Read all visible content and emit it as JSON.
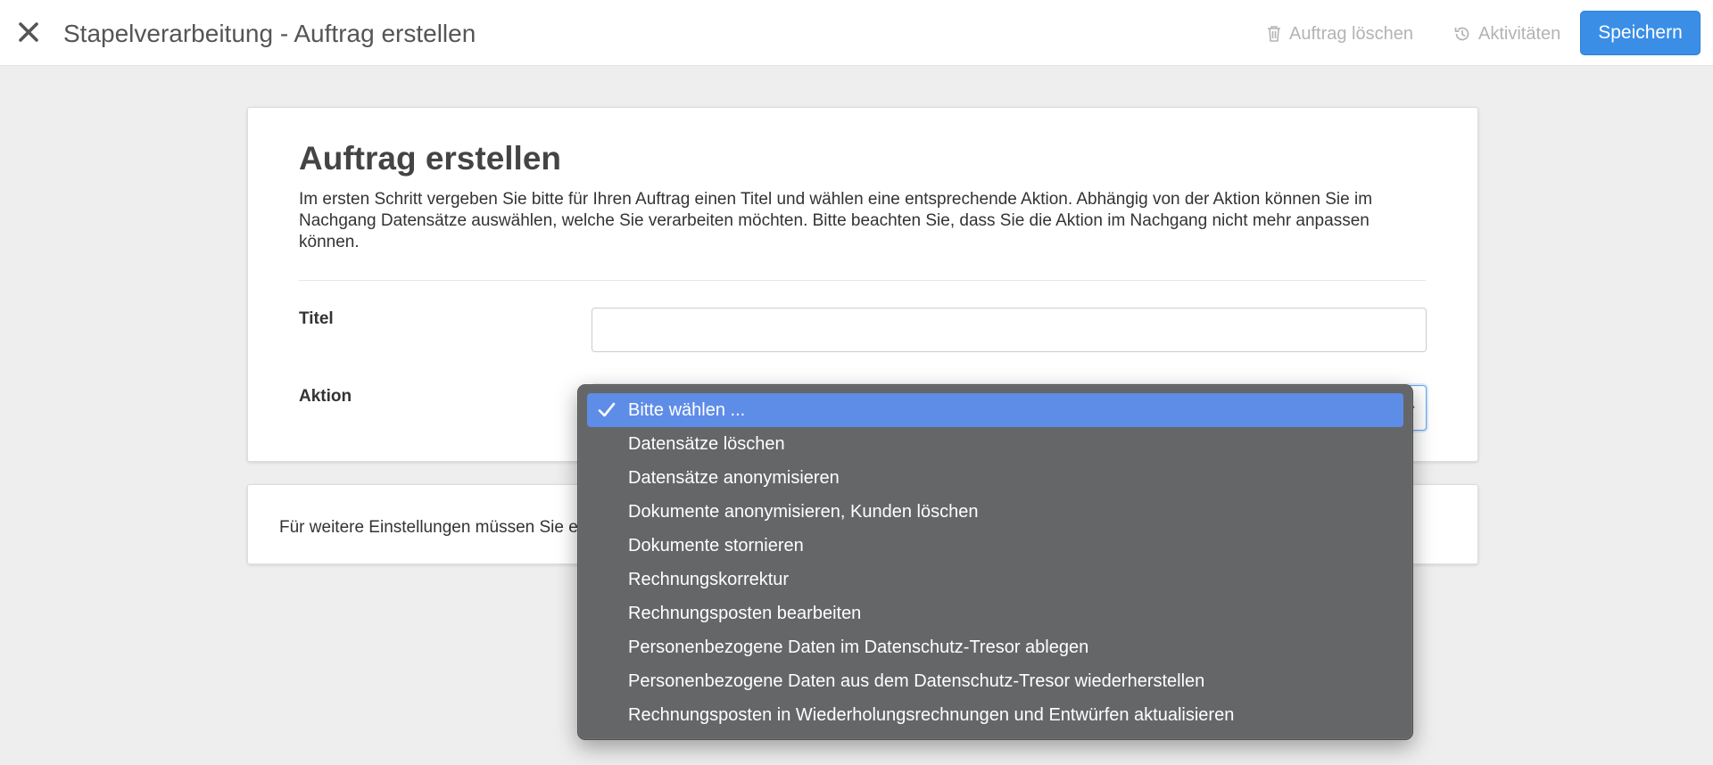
{
  "header": {
    "title": "Stapelverarbeitung - Auftrag erstellen",
    "delete_label": "Auftrag löschen",
    "activities_label": "Aktivitäten",
    "save_label": "Speichern"
  },
  "form": {
    "heading": "Auftrag erstellen",
    "description": "Im ersten Schritt vergeben Sie bitte für Ihren Auftrag einen Titel und wählen eine entsprechende Aktion. Abhängig von der Aktion können Sie im Nachgang Datensätze auswählen, welche Sie verarbeiten möchten. Bitte beachten Sie, dass Sie die Aktion im Nachgang nicht mehr anpassen können.",
    "title_label": "Titel",
    "title_value": "",
    "action_label": "Aktion"
  },
  "info": {
    "text": "Für weitere Einstellungen müssen Sie e"
  },
  "dropdown": {
    "selected_index": 0,
    "options": [
      "Bitte wählen ...",
      "Datensätze löschen",
      "Datensätze anonymisieren",
      "Dokumente anonymisieren, Kunden löschen",
      "Dokumente stornieren",
      "Rechnungskorrektur",
      "Rechnungsposten bearbeiten",
      "Personenbezogene Daten im Datenschutz-Tresor ablegen",
      "Personenbezogene Daten aus dem Datenschutz-Tresor wiederherstellen",
      "Rechnungsposten in Wiederholungsrechnungen und Entwürfen aktualisieren"
    ]
  },
  "icons": {
    "close": "close-icon",
    "delete": "trash-icon",
    "activities": "history-icon",
    "check": "check-icon",
    "chevron": "chevron-down-icon"
  },
  "colors": {
    "primary": "#3a8ee6",
    "menu_background": "#656668",
    "menu_highlight": "#5e8de8"
  }
}
